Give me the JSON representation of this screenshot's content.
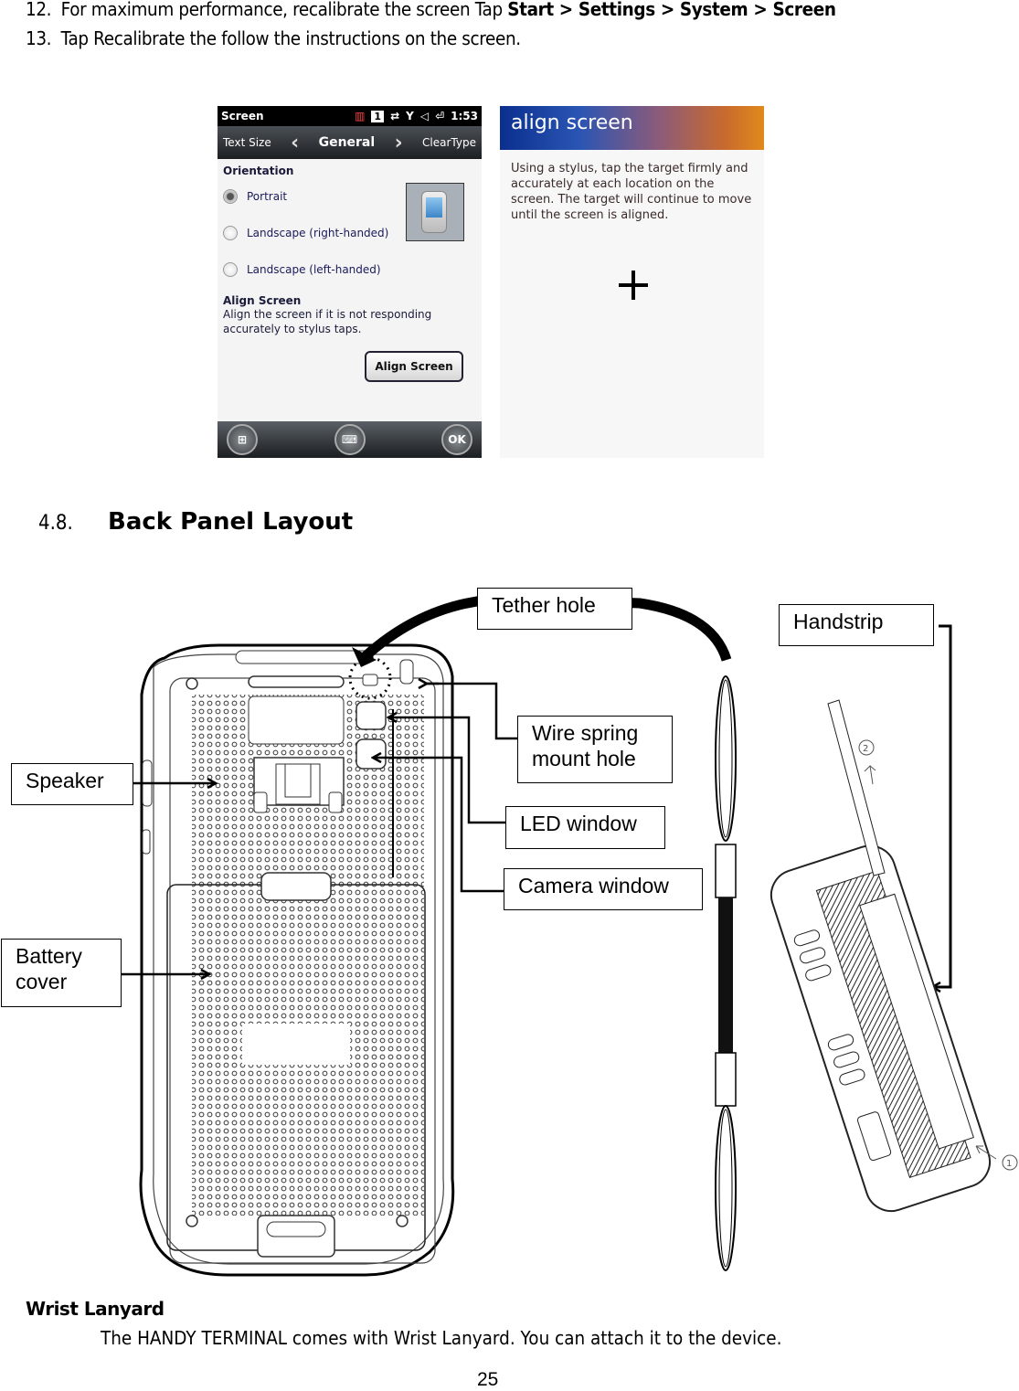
{
  "steps": [
    {
      "number": "12.",
      "text": "For maximum performance, recalibrate the screen Tap ",
      "bold": "Start > Settings > System > Screen"
    },
    {
      "number": "13.",
      "text": "Tap Recalibrate the follow the instructions on the screen.",
      "bold": ""
    }
  ],
  "screen_settings": {
    "title": "Screen",
    "status_time": "1:53",
    "status_badge": "1",
    "tabs": {
      "prev": "Text Size",
      "current": "General",
      "next": "ClearType"
    },
    "orientation_header": "Orientation",
    "options": [
      {
        "label": "Portrait",
        "selected": true
      },
      {
        "label": "Landscape (right-handed)",
        "selected": false
      },
      {
        "label": "Landscape (left-handed)",
        "selected": false
      }
    ],
    "align_header": "Align Screen",
    "align_desc": "Align the screen if it is not responding accurately to stylus taps.",
    "align_button": "Align Screen",
    "softkeys": {
      "start": "start-icon",
      "keyboard": "keyboard-icon",
      "ok": "OK"
    }
  },
  "align_screen": {
    "title": "align screen",
    "instructions": "Using a stylus, tap the target firmly and accurately at each location on the screen. The target will continue to move until the screen is aligned."
  },
  "section": {
    "number": "4.8.",
    "title": "Back Panel Layout"
  },
  "diagram_labels": {
    "tether_hole": "Tether hole",
    "handstrip": "Handstrip",
    "wire_spring": "Wire spring mount hole",
    "wire_spring_l1": "Wire spring",
    "wire_spring_l2": "mount hole",
    "led_window": "LED window",
    "camera_window": "Camera window",
    "speaker": "Speaker",
    "battery_l1": "Battery",
    "battery_l2": "cover"
  },
  "wrist_lanyard": {
    "title": "Wrist Lanyard",
    "body": "The HANDY TERMINAL comes with Wrist Lanyard. You can attach it to the device."
  },
  "page_number": "25"
}
